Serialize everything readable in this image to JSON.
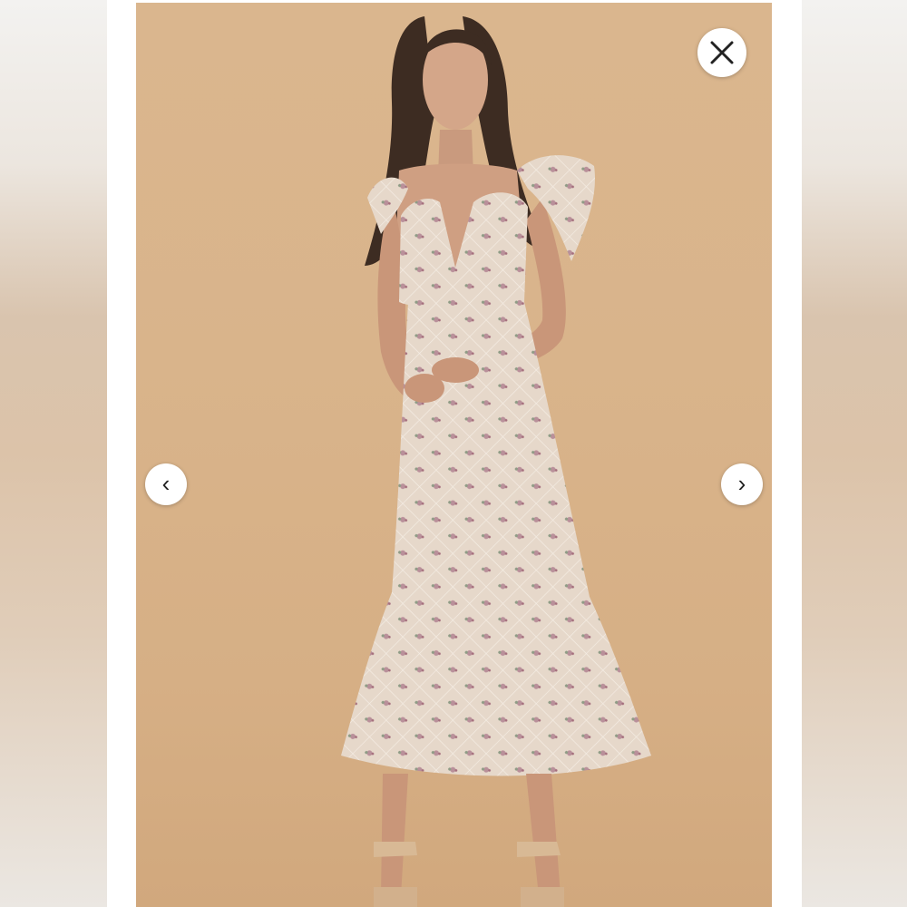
{
  "viewer": {
    "prev_symbol": "‹",
    "next_symbol": "›",
    "close_icon": "close-icon",
    "photo_subject": "product-photo"
  },
  "colors": {
    "backdrop": "#d9b48b",
    "frame": "#ffffff",
    "dress": "#e4d5c6",
    "button": "#ffffff"
  }
}
